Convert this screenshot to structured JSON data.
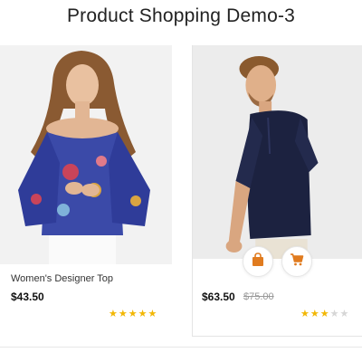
{
  "page": {
    "title": "Product Shopping Demo-3"
  },
  "products": [
    {
      "name": "Women's Designer Top",
      "price": "$43.50",
      "old_price": "",
      "rating": 5,
      "rating_max": 5
    },
    {
      "name": "",
      "price": "$63.50",
      "old_price": "$75.00",
      "rating": 3,
      "rating_max": 5,
      "actions": {
        "bag_icon": "shopping-bag-icon",
        "cart_icon": "shopping-cart-icon"
      }
    }
  ],
  "colors": {
    "accent": "#e07b1f",
    "star_on": "#f2b705",
    "star_off": "#d6d6d6"
  }
}
